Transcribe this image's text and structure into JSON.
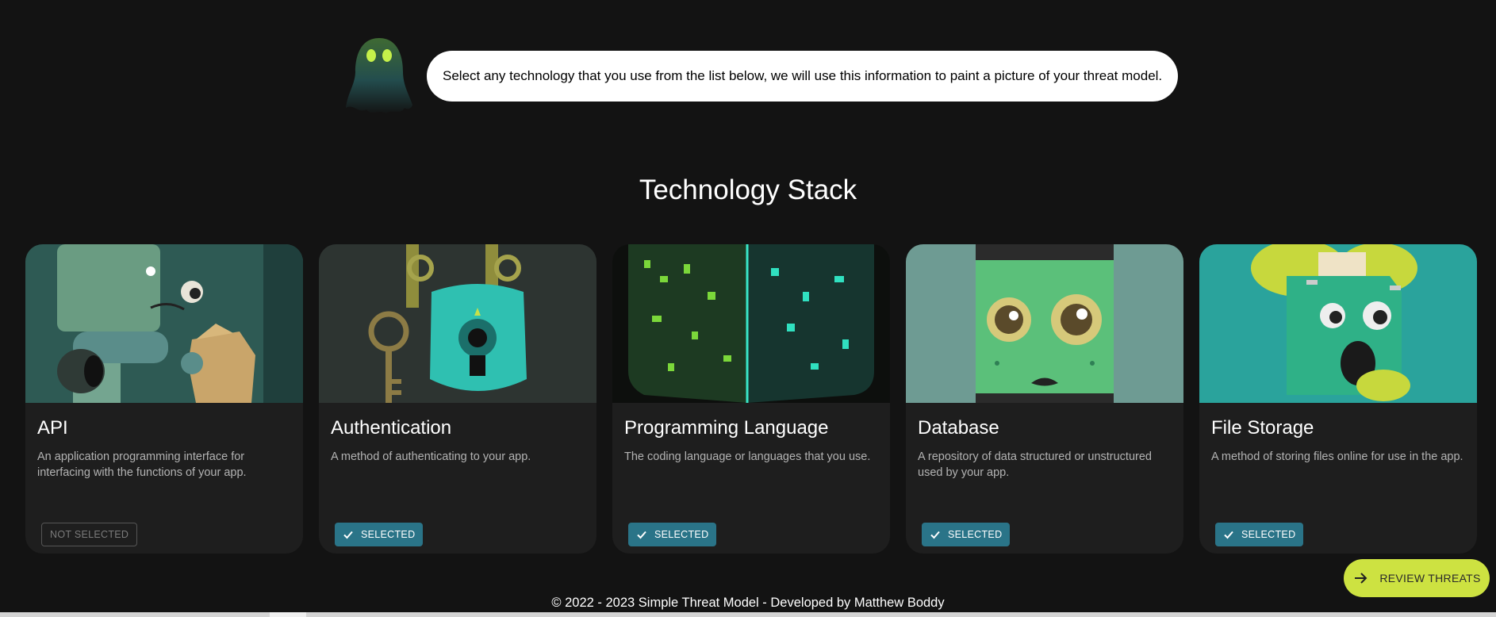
{
  "intro": {
    "message": "Select any technology that you use from the list below, we will use this information to paint a picture of your threat model."
  },
  "page_title": "Technology Stack",
  "cards": [
    {
      "title": "API",
      "description": "An application programming interface for interfacing with the functions of your app.",
      "status": "NOT SELECTED",
      "selected": false
    },
    {
      "title": "Authentication",
      "description": "A method of authenticating to your app.",
      "status": "SELECTED",
      "selected": true
    },
    {
      "title": "Programming Language",
      "description": "The coding language or languages that you use.",
      "status": "SELECTED",
      "selected": true
    },
    {
      "title": "Database",
      "description": "A repository of data structured or unstructured used by your app.",
      "status": "SELECTED",
      "selected": true
    },
    {
      "title": "File Storage",
      "description": "A method of storing files online for use in the app.",
      "status": "SELECTED",
      "selected": true
    }
  ],
  "review_button": {
    "label": "REVIEW THREATS",
    "icon": "arrow-right-icon"
  },
  "footer": "© 2022 - 2023 Simple Threat Model - Developed by Matthew Boddy",
  "colors": {
    "background": "#131313",
    "card": "#1e1e1e",
    "selected": "#2a7488",
    "accent": "#cde241"
  }
}
